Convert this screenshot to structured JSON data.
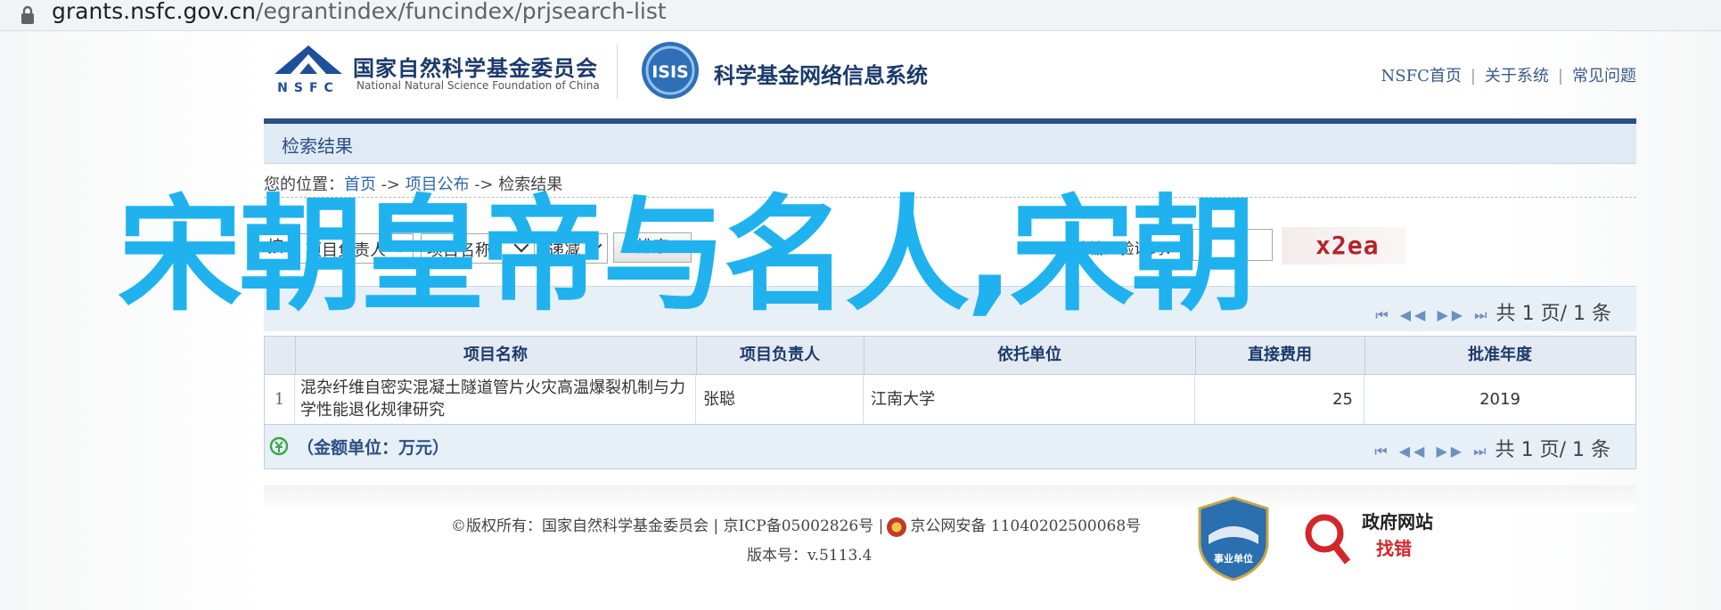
{
  "browser": {
    "url_host": "grants.nsfc.gov.cn",
    "url_path": "/egrantindex/funcindex/prjsearch-list"
  },
  "header": {
    "org_cn": "国家自然科学基金委员会",
    "org_en": "National Natural Science Foundation of China",
    "nsfc_logo_text": "NSFC",
    "isis_logo_text": "ISIS",
    "system_title": "科学基金网络信息系统",
    "nav": [
      "NSFC首页",
      "关于系统",
      "常见问题"
    ],
    "nav_sep": "|"
  },
  "results": {
    "title": "检索结果",
    "breadcrumb_prefix": "您的位置：",
    "breadcrumb": [
      "首页",
      "项目公布",
      "检索结果"
    ],
    "breadcrumb_sep": " -> "
  },
  "filter": {
    "by_label": "按：",
    "field1": "项目负责人",
    "field2": "项目名称",
    "order": "递减",
    "sort_button": "排序",
    "captcha_req": "*",
    "captcha_label": "请输入验证码：",
    "captcha_value": "",
    "captcha_text": "x2ea"
  },
  "pager": {
    "nav_icons": "⏮ ◀◀ ▶▶ ⏭",
    "text_prefix": "共",
    "current": "1",
    "text_mid": "页/",
    "total": "1",
    "text_suffix": "条"
  },
  "table": {
    "columns": [
      "",
      "项目名称",
      "项目负责人",
      "依托单位",
      "直接费用",
      "批准年度"
    ],
    "rows": [
      {
        "index": "1",
        "name": "混杂纤维自密实混凝土隧道管片火灾高温爆裂机制与力学性能退化规律研究",
        "leader": "张聪",
        "unit": "江南大学",
        "amount": "25",
        "year": "2019"
      }
    ],
    "footer_note": "（金额单位：万元）"
  },
  "footer": {
    "copyright": "©版权所有：国家自然科学基金委员会 | 京ICP备05002826号 |",
    "police": "京公网安备 11040202500068号",
    "version_label": "版本号：",
    "version": "v.5113.4",
    "shield_text": "事业单位",
    "gov_title": "政府网站",
    "gov_sub": "找错"
  },
  "overlay": {
    "text": "宋朝皇帝与名人,宋朝"
  },
  "colors": {
    "nav_blue": "#2c4f84",
    "overlay_cyan": "#1fb2ef",
    "captcha_red": "#b4242c"
  }
}
